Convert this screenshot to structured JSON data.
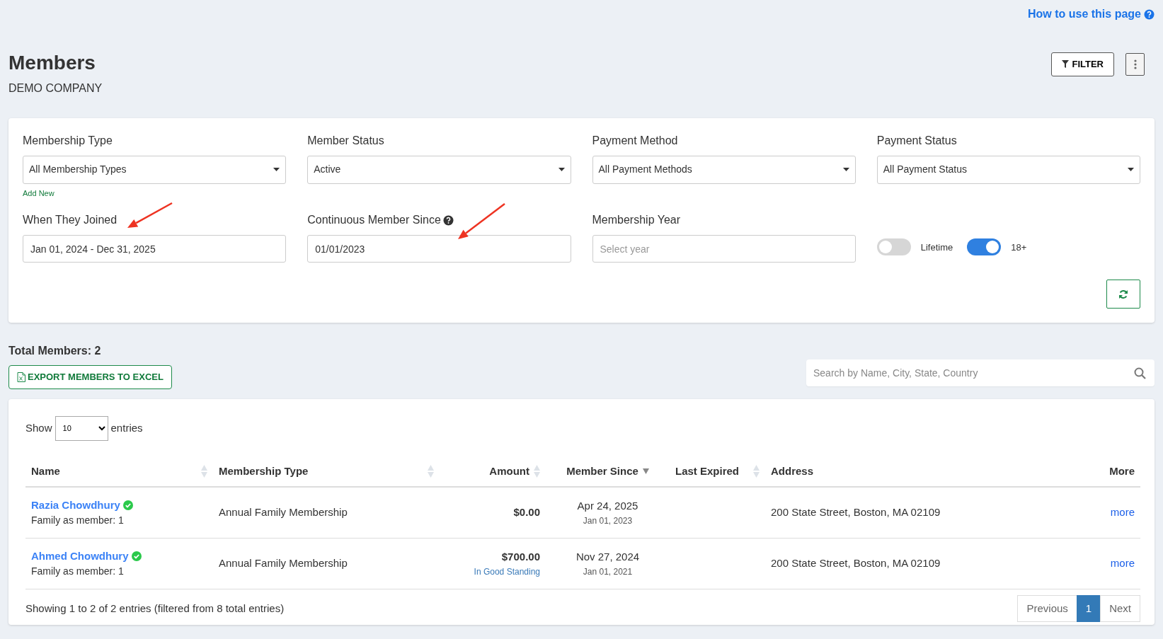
{
  "help_link": {
    "label": "How to use this page"
  },
  "header": {
    "title": "Members",
    "subtitle": "DEMO COMPANY",
    "filter_button": "FILTER"
  },
  "filters": [
    {
      "kind": "select",
      "label": "Membership Type",
      "value": "All Membership Types",
      "link": "Add New"
    },
    {
      "kind": "select",
      "label": "Member Status",
      "value": "Active"
    },
    {
      "kind": "select",
      "label": "Payment Method",
      "value": "All Payment Methods"
    },
    {
      "kind": "select",
      "label": "Payment Status",
      "value": "All Payment Status"
    },
    {
      "kind": "input",
      "label": "When They Joined",
      "value": "Jan 01, 2024 - Dec 31, 2025"
    },
    {
      "kind": "input",
      "label": "Continuous Member Since",
      "value": "01/01/2023",
      "help": true
    },
    {
      "kind": "input",
      "label": "Membership Year",
      "placeholder": "Select year"
    },
    {
      "kind": "toggles",
      "toggles": [
        {
          "label": "Lifetime",
          "on": false
        },
        {
          "label": "18+",
          "on": true
        }
      ]
    }
  ],
  "total": "Total Members: 2",
  "export_button": "EXPORT MEMBERS TO EXCEL",
  "search": {
    "placeholder": "Search by Name, City, State, Country"
  },
  "table": {
    "show_label": "Show",
    "page_size": "10",
    "entries_label": "entries",
    "columns": [
      {
        "label": "Name",
        "sortable": true,
        "sorted_desc": false
      },
      {
        "label": "Membership Type",
        "sortable": true,
        "sorted_desc": false
      },
      {
        "label": "Amount",
        "sortable": true,
        "sorted_desc": false
      },
      {
        "label": "Member Since",
        "sortable": true,
        "sorted_desc": true
      },
      {
        "label": "Last Expired",
        "sortable": true,
        "sorted_desc": false
      },
      {
        "label": "Address"
      },
      {
        "label": "More"
      }
    ],
    "rows": [
      {
        "name": "Razia Chowdhury",
        "verified": true,
        "family": "Family as member: 1",
        "type": "Annual Family Membership",
        "amount": "$0.00",
        "member_since": "Apr 24, 2025",
        "since_original": "Jan 01, 2023",
        "address": "200 State Street, Boston, MA 02109",
        "more": "more"
      },
      {
        "name": "Ahmed Chowdhury",
        "verified": true,
        "family": "Family as member: 1",
        "type": "Annual Family Membership",
        "amount": "$700.00",
        "amount_status": "In Good Standing",
        "member_since": "Nov 27, 2024",
        "since_original": "Jan 01, 2021",
        "address": "200 State Street, Boston, MA 02109",
        "more": "more"
      }
    ],
    "info": "Showing 1 to 2 of 2 entries (filtered from 8 total entries)",
    "pagination": [
      {
        "label": "Previous",
        "selected": false
      },
      {
        "label": "1",
        "selected": true
      },
      {
        "label": "Next",
        "selected": false
      }
    ]
  }
}
